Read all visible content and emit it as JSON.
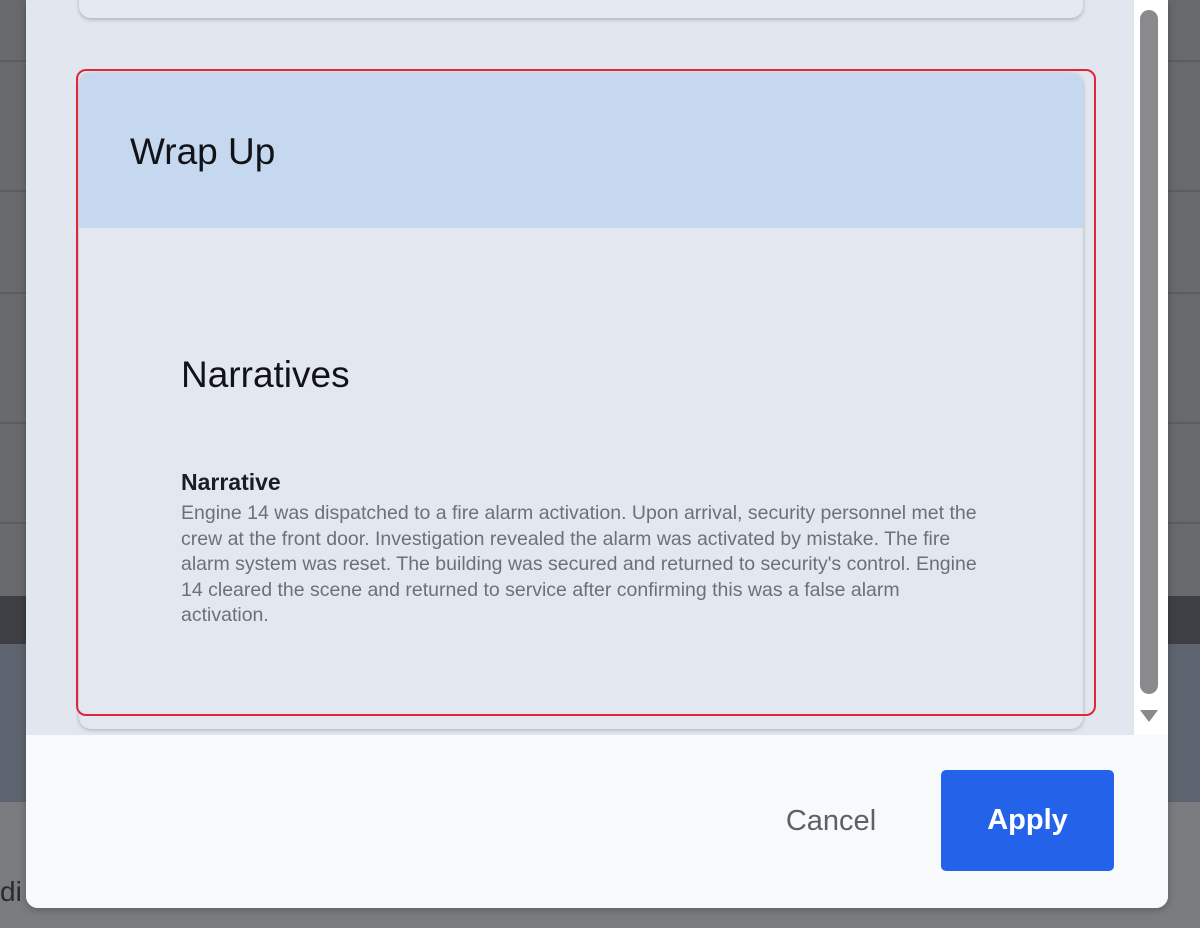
{
  "background": {
    "partial_text": "di"
  },
  "wrap_up_card": {
    "title": "Wrap Up",
    "section_title": "Narratives",
    "field_label": "Narrative",
    "field_value": "Engine 14 was dispatched to a fire alarm activation. Upon arrival, security personnel met the crew at the front door. Investigation revealed the alarm was activated by mistake. The fire alarm system was reset. The building was secured and returned to security's control. Engine 14 cleared the scene and returned to service after confirming this was a false alarm activation."
  },
  "footer": {
    "cancel_label": "Cancel",
    "apply_label": "Apply"
  },
  "colors": {
    "accent": "#2463e9",
    "card_header": "#c6d7f0",
    "highlight": "#e0263c"
  }
}
